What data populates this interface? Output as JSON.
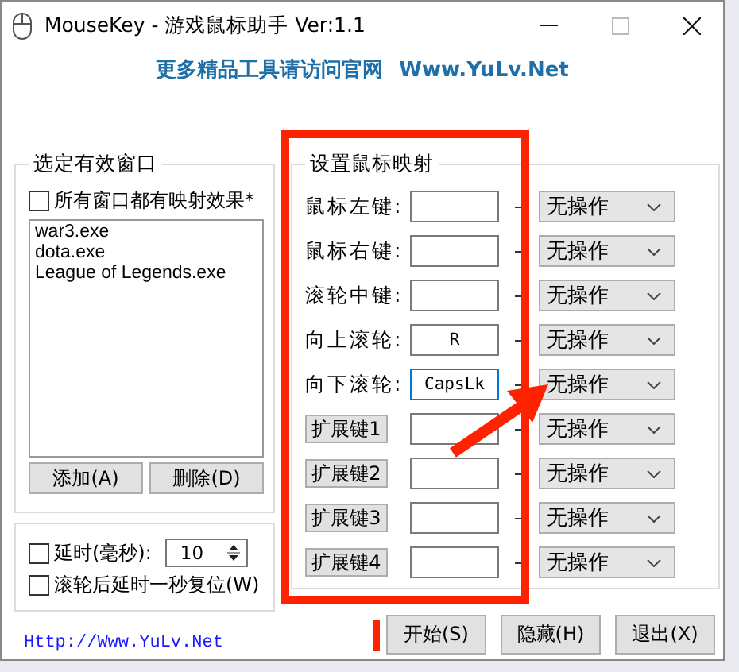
{
  "window": {
    "title": "MouseKey - 游戏鼠标助手 Ver:1.1"
  },
  "banner": {
    "text": "更多精品工具请访问官网",
    "site": "Www.YuLv.Net"
  },
  "window_group": {
    "title": "选定有效窗口",
    "all_windows": {
      "label": "所有窗口都有映射效果*",
      "checked": false
    },
    "processes": [
      "war3.exe",
      "dota.exe",
      "League of Legends.exe"
    ],
    "buttons": [
      "添加(A)",
      "删除(D)"
    ]
  },
  "options": {
    "delay": {
      "label": "延时(毫秒):",
      "checked": false,
      "value": "10"
    },
    "reset": {
      "label": "滚轮后延时一秒复位(W)",
      "checked": false
    }
  },
  "mapping_group": {
    "title": "设置鼠标映射",
    "rows": [
      {
        "kind": "label",
        "label": "鼠标左键:",
        "key": "",
        "focused": false,
        "action": "无操作"
      },
      {
        "kind": "label",
        "label": "鼠标右键:",
        "key": "",
        "focused": false,
        "action": "无操作"
      },
      {
        "kind": "label",
        "label": "滚轮中键:",
        "key": "",
        "focused": false,
        "action": "无操作"
      },
      {
        "kind": "label",
        "label": "向上滚轮:",
        "key": "R",
        "focused": false,
        "action": "无操作"
      },
      {
        "kind": "label",
        "label": "向下滚轮:",
        "key": "CapsLk",
        "focused": true,
        "action": "无操作"
      },
      {
        "kind": "button",
        "label": "扩展键1",
        "key": "",
        "focused": false,
        "action": "无操作"
      },
      {
        "kind": "button",
        "label": "扩展键2",
        "key": "",
        "focused": false,
        "action": "无操作"
      },
      {
        "kind": "button",
        "label": "扩展键3",
        "key": "",
        "focused": false,
        "action": "无操作"
      },
      {
        "kind": "button",
        "label": "扩展键4",
        "key": "",
        "focused": false,
        "action": "无操作"
      }
    ]
  },
  "footer": {
    "link": "Http://Www.YuLv.Net",
    "buttons": [
      "开始(S)",
      "隐藏(H)",
      "退出(X)"
    ]
  },
  "annotations": [
    {
      "kind": "rectangle"
    },
    {
      "kind": "arrow"
    },
    {
      "kind": "bar"
    }
  ]
}
